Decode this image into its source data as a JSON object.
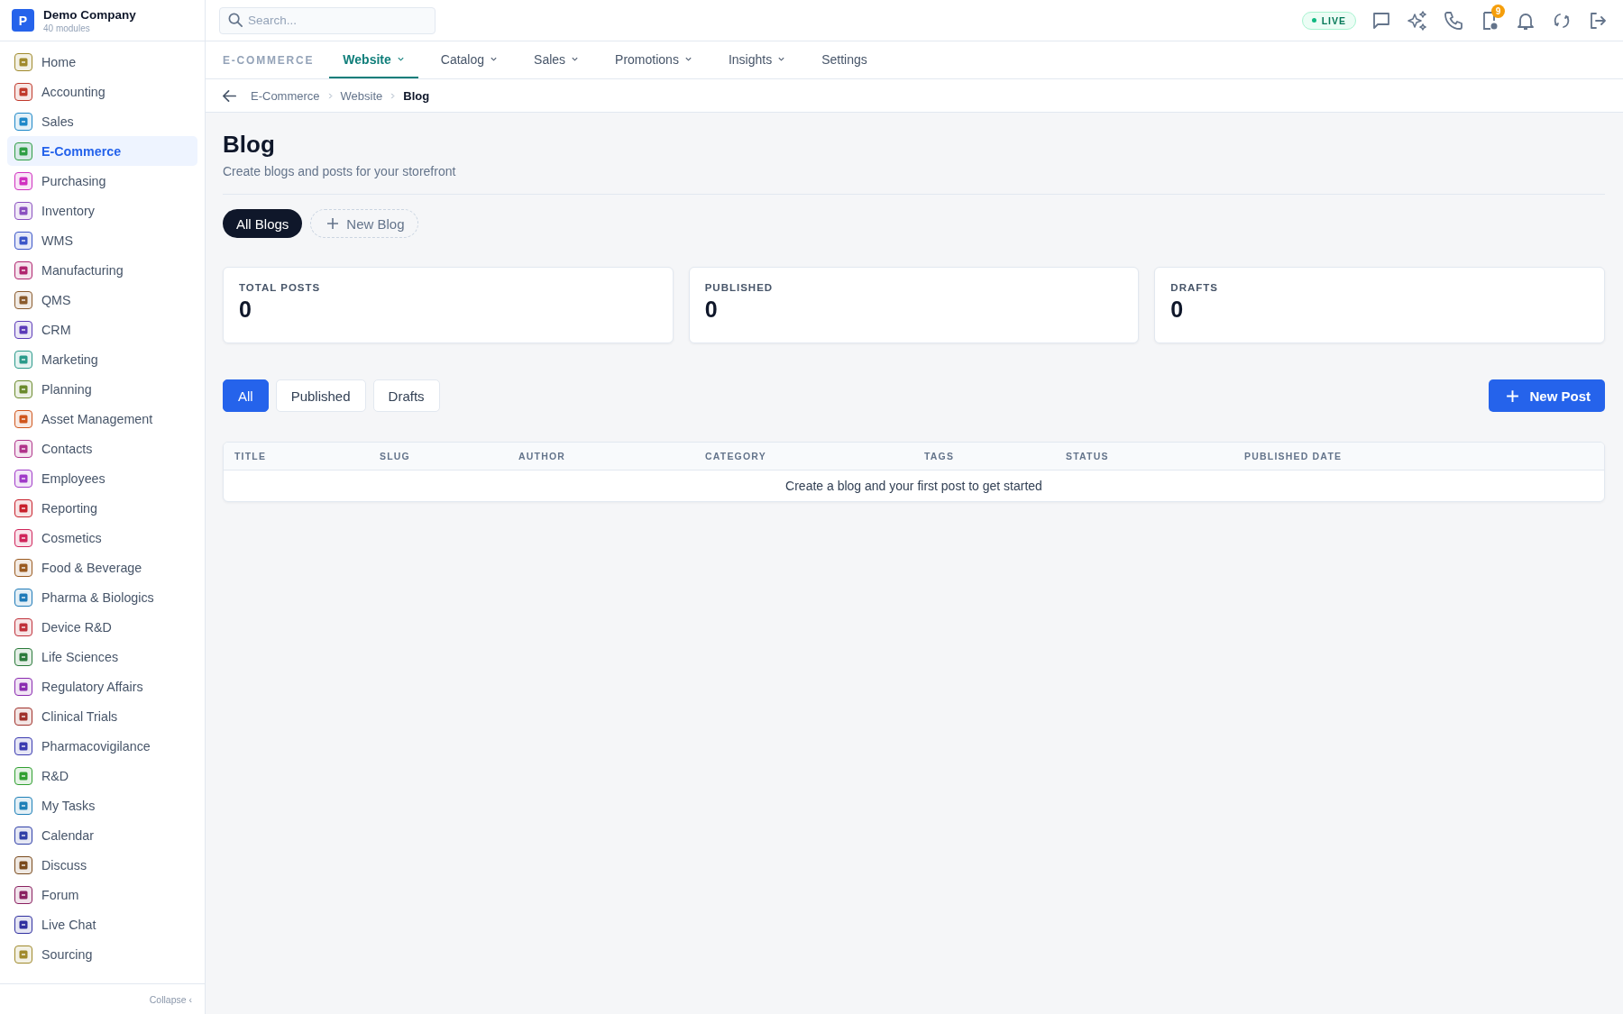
{
  "company": {
    "logo": "P",
    "name": "Demo Company",
    "subtitle": "40 modules"
  },
  "sidebar": {
    "items": [
      {
        "label": "Home",
        "selected": false,
        "color": "#a08a2c"
      },
      {
        "label": "Accounting",
        "selected": false,
        "color": "#c0392b"
      },
      {
        "label": "Sales",
        "selected": false,
        "color": "#1e88c8"
      },
      {
        "label": "E-Commerce",
        "selected": true,
        "color": "#2e9e44"
      },
      {
        "label": "Purchasing",
        "selected": false,
        "color": "#d02fc0"
      },
      {
        "label": "Inventory",
        "selected": false,
        "color": "#8a4fc0"
      },
      {
        "label": "WMS",
        "selected": false,
        "color": "#3a55c8"
      },
      {
        "label": "Manufacturing",
        "selected": false,
        "color": "#b0246e"
      },
      {
        "label": "QMS",
        "selected": false,
        "color": "#8a5a2c"
      },
      {
        "label": "CRM",
        "selected": false,
        "color": "#5b3ab8"
      },
      {
        "label": "Marketing",
        "selected": false,
        "color": "#2a9a8a"
      },
      {
        "label": "Planning",
        "selected": false,
        "color": "#6a8a2c"
      },
      {
        "label": "Asset Management",
        "selected": false,
        "color": "#d0561c"
      },
      {
        "label": "Contacts",
        "selected": false,
        "color": "#b0348a"
      },
      {
        "label": "Employees",
        "selected": false,
        "color": "#a03ac8"
      },
      {
        "label": "Reporting",
        "selected": false,
        "color": "#c8202c"
      },
      {
        "label": "Cosmetics",
        "selected": false,
        "color": "#d0245a"
      },
      {
        "label": "Food & Beverage",
        "selected": false,
        "color": "#9a5a20"
      },
      {
        "label": "Pharma & Biologics",
        "selected": false,
        "color": "#1e7ab8"
      },
      {
        "label": "Device R&D",
        "selected": false,
        "color": "#c0303a"
      },
      {
        "label": "Life Sciences",
        "selected": false,
        "color": "#2a7a3a"
      },
      {
        "label": "Regulatory Affairs",
        "selected": false,
        "color": "#8a2ab0"
      },
      {
        "label": "Clinical Trials",
        "selected": false,
        "color": "#a0302a"
      },
      {
        "label": "Pharmacovigilance",
        "selected": false,
        "color": "#3a3ab0"
      },
      {
        "label": "R&D",
        "selected": false,
        "color": "#30a030"
      },
      {
        "label": "My Tasks",
        "selected": false,
        "color": "#1e80b8"
      },
      {
        "label": "Calendar",
        "selected": false,
        "color": "#3040a8"
      },
      {
        "label": "Discuss",
        "selected": false,
        "color": "#7a4a1c"
      },
      {
        "label": "Forum",
        "selected": false,
        "color": "#8a2060"
      },
      {
        "label": "Live Chat",
        "selected": false,
        "color": "#3030a0"
      },
      {
        "label": "Sourcing",
        "selected": false,
        "color": "#a08a2c"
      }
    ],
    "collapse": "Collapse",
    "collapse_glyph": "‹"
  },
  "search": {
    "placeholder": "Search..."
  },
  "status_badge": "LIVE",
  "notification_count": "9",
  "module_label": "E-COMMERCE",
  "tabs": [
    {
      "label": "Website",
      "selected": true,
      "dropdown": true
    },
    {
      "label": "Catalog",
      "selected": false,
      "dropdown": true
    },
    {
      "label": "Sales",
      "selected": false,
      "dropdown": true
    },
    {
      "label": "Promotions",
      "selected": false,
      "dropdown": true
    },
    {
      "label": "Insights",
      "selected": false,
      "dropdown": true
    },
    {
      "label": "Settings",
      "selected": false,
      "dropdown": false
    }
  ],
  "breadcrumb": [
    "E-Commerce",
    "Website",
    "Blog"
  ],
  "page": {
    "title": "Blog",
    "subtitle": "Create blogs and posts for your storefront"
  },
  "blog_chips": [
    {
      "label": "All Blogs",
      "selected": true,
      "kind": "chip"
    },
    {
      "label": "New Blog",
      "selected": false,
      "kind": "add"
    }
  ],
  "stats": [
    {
      "label": "TOTAL POSTS",
      "value": "0"
    },
    {
      "label": "PUBLISHED",
      "value": "0"
    },
    {
      "label": "DRAFTS",
      "value": "0"
    }
  ],
  "filters": [
    {
      "label": "All",
      "selected": true
    },
    {
      "label": "Published",
      "selected": false
    },
    {
      "label": "Drafts",
      "selected": false
    }
  ],
  "new_post": "New Post",
  "table": {
    "columns": [
      "TITLE",
      "SLUG",
      "AUTHOR",
      "CATEGORY",
      "TAGS",
      "STATUS",
      "PUBLISHED DATE"
    ],
    "empty": "Create a blog and your first post to get started"
  }
}
